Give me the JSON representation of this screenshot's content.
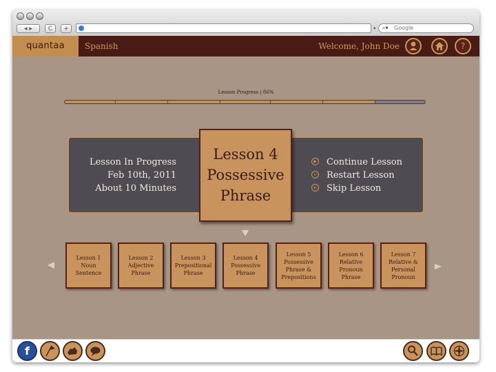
{
  "browser": {
    "search_placeholder": "Google",
    "back_label": "◂ ▸",
    "reload_label": "C",
    "add_label": "+"
  },
  "header": {
    "logo": "quantaa",
    "subject": "Spanish",
    "welcome": "Welcome, John Doe",
    "profile_icon": "person-icon",
    "home_icon": "home-icon",
    "help_label": "?"
  },
  "progress": {
    "label": "Lesson Progress | 86%",
    "percent": 86
  },
  "current": {
    "status": "Lesson In Progress",
    "date": "Feb 10th, 2011",
    "duration": "About 10 Minutes",
    "card_lines": [
      "Lesson 4",
      "Possessive",
      "Phrase"
    ],
    "actions": [
      {
        "label": "Continue Lesson",
        "icon": "play-icon"
      },
      {
        "label": "Restart Lesson",
        "icon": "restart-icon"
      },
      {
        "label": "Skip Lesson",
        "icon": "skip-icon"
      }
    ]
  },
  "lessons": [
    {
      "lines": [
        "Lesson 1",
        "Noun",
        "Sentence"
      ]
    },
    {
      "lines": [
        "Lesson 2",
        "Adjective",
        "Phrase"
      ]
    },
    {
      "lines": [
        "Lesson 3",
        "Prepositional",
        "Phrase"
      ]
    },
    {
      "lines": [
        "Lesson 4",
        "Possessive",
        "Phrase"
      ]
    },
    {
      "lines": [
        "Lesson 5",
        "Possessive",
        "Phrase &",
        "Prepositions"
      ]
    },
    {
      "lines": [
        "Lesson 6",
        "Relative",
        "Pronoun",
        "Phrase"
      ]
    },
    {
      "lines": [
        "Lesson 7",
        "Relative &",
        "Personal",
        "Pronoun"
      ]
    }
  ],
  "footer": {
    "left_icons": [
      "facebook-icon",
      "flag-icon",
      "map-region-icon",
      "speech-bubble-icon"
    ],
    "right_icons": [
      "search-icon",
      "book-icon",
      "compass-icon"
    ],
    "facebook_label": "f"
  },
  "colors": {
    "background": "#a89585",
    "header": "#4a1a14",
    "accent": "#c9935e",
    "panel": "#4e4b53"
  }
}
